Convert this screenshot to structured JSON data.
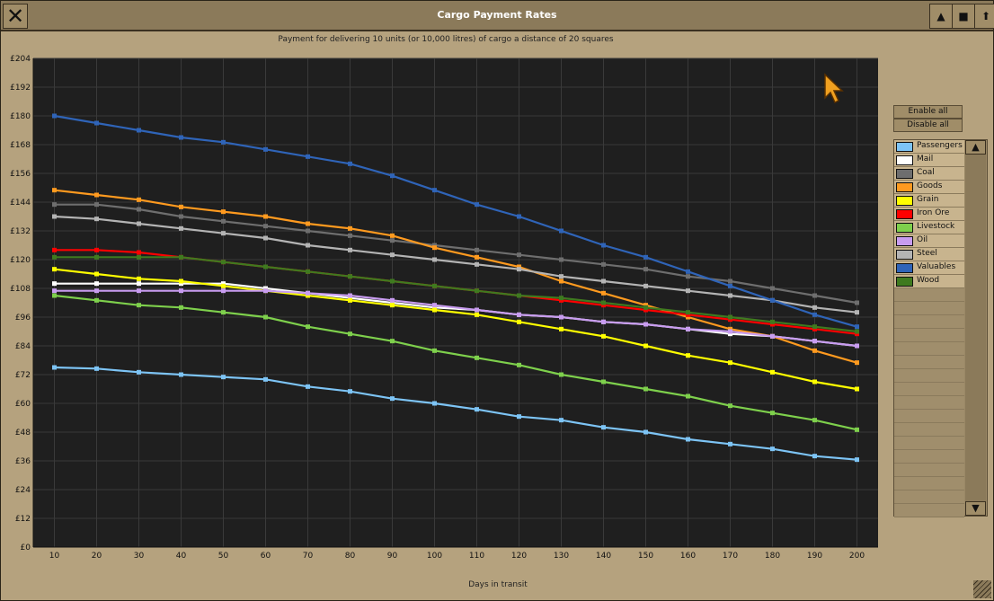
{
  "window": {
    "title": "Cargo Payment Rates",
    "subtitle": "Payment for delivering 10 units (or 10,000 litres) of cargo a distance of 20 squares"
  },
  "toolbar": {
    "close_icon": "close-icon",
    "shade_icon": "shade-icon",
    "defsize_icon": "defsize-icon",
    "sticky_icon": "pin-icon"
  },
  "side": {
    "enable_all": "Enable all",
    "disable_all": "Disable all"
  },
  "chart_data": {
    "type": "line",
    "title": "Cargo Payment Rates",
    "xlabel": "Days in transit",
    "ylabel": "",
    "x": [
      10,
      20,
      30,
      40,
      50,
      60,
      70,
      80,
      90,
      100,
      110,
      120,
      130,
      140,
      150,
      160,
      170,
      180,
      190,
      200
    ],
    "ylim": [
      0,
      204
    ],
    "yticks": [
      0,
      12,
      24,
      36,
      48,
      60,
      72,
      84,
      96,
      108,
      120,
      132,
      144,
      156,
      168,
      180,
      192,
      204
    ],
    "ytick_labels": [
      "£0",
      "£12",
      "£24",
      "£36",
      "£48",
      "£60",
      "£72",
      "£84",
      "£96",
      "£108",
      "£120",
      "£132",
      "£144",
      "£156",
      "£168",
      "£180",
      "£192",
      "£204"
    ],
    "grid": true,
    "series": [
      {
        "name": "Passengers",
        "color": "#7dc4f5",
        "values": [
          75,
          74.5,
          73,
          72,
          71,
          70,
          67,
          65,
          62,
          60,
          57.5,
          54.5,
          53,
          50,
          48,
          45,
          43,
          41,
          38,
          36.5
        ]
      },
      {
        "name": "Mail",
        "color": "#ffffff",
        "values": [
          110,
          110,
          110,
          110,
          110,
          108,
          106,
          104,
          102,
          100,
          99,
          97,
          96,
          94,
          93,
          91,
          89,
          88,
          86,
          84
        ]
      },
      {
        "name": "Coal",
        "color": "#6e6e6e",
        "values": [
          143,
          143,
          141,
          138,
          136,
          134,
          132,
          130,
          128,
          126,
          124,
          122,
          120,
          118,
          116,
          113,
          111,
          108,
          105,
          102
        ]
      },
      {
        "name": "Goods",
        "color": "#ff9a1f",
        "values": [
          149,
          147,
          145,
          142,
          140,
          138,
          135,
          133,
          130,
          125,
          121,
          117,
          111,
          106,
          101,
          96,
          91,
          88,
          82,
          77
        ]
      },
      {
        "name": "Grain",
        "color": "#ffff00",
        "values": [
          116,
          114,
          112,
          111,
          109,
          107,
          105,
          103,
          101,
          99,
          97,
          94,
          91,
          88,
          84,
          80,
          77,
          73,
          69,
          66
        ]
      },
      {
        "name": "Iron Ore",
        "color": "#ff0000",
        "values": [
          124,
          124,
          123,
          121,
          119,
          117,
          115,
          113,
          111,
          109,
          107,
          105,
          103,
          101,
          99,
          97,
          95,
          93,
          91,
          89
        ]
      },
      {
        "name": "Livestock",
        "color": "#7ed04c",
        "values": [
          105,
          103,
          101,
          100,
          98,
          96,
          92,
          89,
          86,
          82,
          79,
          76,
          72,
          69,
          66,
          63,
          59,
          56,
          53,
          49
        ]
      },
      {
        "name": "Oil",
        "color": "#c89cf0",
        "values": [
          107,
          107,
          107,
          107,
          107,
          107,
          106,
          105,
          103,
          101,
          99,
          97,
          96,
          94,
          93,
          91,
          90,
          88,
          86,
          84
        ]
      },
      {
        "name": "Steel",
        "color": "#b4b4b4",
        "values": [
          138,
          137,
          135,
          133,
          131,
          129,
          126,
          124,
          122,
          120,
          118,
          116,
          113,
          111,
          109,
          107,
          105,
          103,
          100,
          98
        ]
      },
      {
        "name": "Valuables",
        "color": "#2f64b8",
        "values": [
          180,
          177,
          174,
          171,
          169,
          166,
          163,
          160,
          155,
          149,
          143,
          138,
          132,
          126,
          121,
          115,
          109,
          103,
          97,
          92
        ]
      },
      {
        "name": "Wood",
        "color": "#3f7a1f",
        "values": [
          121,
          121,
          121,
          121,
          119,
          117,
          115,
          113,
          111,
          109,
          107,
          105,
          104,
          102,
          100,
          98,
          96,
          94,
          92,
          90
        ]
      }
    ]
  }
}
